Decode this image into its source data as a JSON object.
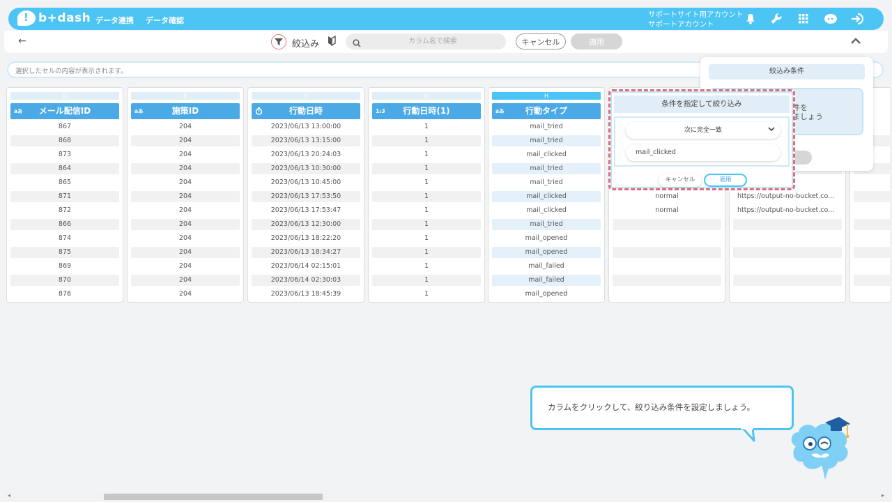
{
  "header": {
    "logo_text": "b+dash",
    "nav": [
      "データ連携",
      "データ確認"
    ],
    "account_line1": "サポートサイト用アカウント",
    "account_line2": "サポートアカウント",
    "icons": [
      "bell-icon",
      "wrench-icon",
      "grid-icon",
      "chat-icon",
      "logout-icon"
    ]
  },
  "toolbar": {
    "back_label": "←",
    "filter_label": "絞込み",
    "search_placeholder": "カラム名で検索",
    "cancel_label": "キャンセル",
    "apply_label": "適用",
    "collapse_label": "^"
  },
  "cellbar": {
    "placeholder": "選択したセルの内容が表示されます。"
  },
  "columns": [
    {
      "letter": "D",
      "type": "a",
      "header": "メール配信ID",
      "cells": [
        "867",
        "868",
        "873",
        "864",
        "865",
        "871",
        "872",
        "866",
        "874",
        "875",
        "869",
        "870",
        "876"
      ]
    },
    {
      "letter": "E",
      "type": "a",
      "header": "施策ID",
      "cells": [
        "204",
        "204",
        "204",
        "204",
        "204",
        "204",
        "204",
        "204",
        "204",
        "204",
        "204",
        "204",
        "204"
      ]
    },
    {
      "letter": "F",
      "type": "clock",
      "header": "行動日時",
      "cells": [
        "2023/06/13 13:00:00",
        "2023/06/13 13:15:00",
        "2023/06/13 20:24:03",
        "2023/06/13 10:30:00",
        "2023/06/13 10:45:00",
        "2023/06/13 17:53:50",
        "2023/06/13 17:53:47",
        "2023/06/13 12:30:00",
        "2023/06/13 18:22:20",
        "2023/06/13 18:34:27",
        "2023/06/14 02:15:01",
        "2023/06/14 02:30:03",
        "2023/06/13 18:45:39"
      ]
    },
    {
      "letter": "G",
      "type": "123",
      "header": "行動日時(1)",
      "cells": [
        "1",
        "1",
        "1",
        "1",
        "1",
        "1",
        "1",
        "1",
        "1",
        "1",
        "1",
        "1",
        "1"
      ]
    },
    {
      "letter": "H",
      "type": "a",
      "header": "行動タイプ",
      "cells": [
        "mail_tried",
        "mail_tried",
        "mail_clicked",
        "mail_tried",
        "mail_tried",
        "mail_clicked",
        "mail_clicked",
        "mail_tried",
        "mail_opened",
        "mail_opened",
        "mail_failed",
        "mail_failed",
        "mail_opened"
      ]
    }
  ],
  "type_labels": {
    "a": "aあ",
    "123": "1‣2‣3"
  },
  "col_i_cells": [
    "normal",
    "normal"
  ],
  "col_j_cells": [
    "https://output-no-bucket.co...",
    "https://output-no-bucket.co..."
  ],
  "popup": {
    "title": "条件を指定して絞り込み",
    "select_value": "次に完全一致",
    "input_value": "mail_clicked",
    "cancel_label": "キャンセル",
    "apply_label": "適用"
  },
  "cond_panel": {
    "title": "絞込み条件",
    "text_line1": "件を",
    "text_line2": "ましょう"
  },
  "tooltip": {
    "text": "カラムをクリックして、絞り込み条件を設定しましょう。"
  },
  "colors": {
    "brand": "#4cc4f4",
    "header_blue": "#4ba9e6",
    "highlight": "#e06b7d"
  }
}
